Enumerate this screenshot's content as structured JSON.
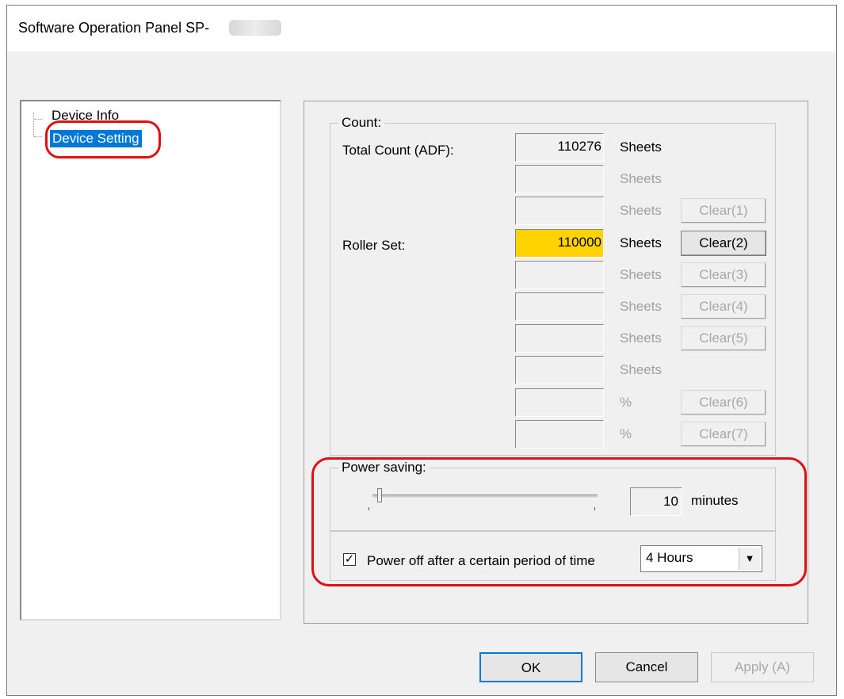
{
  "window": {
    "title": "Software Operation Panel SP-"
  },
  "tree": {
    "items": [
      "Device Info",
      "Device Setting"
    ],
    "selected": "Device Setting"
  },
  "count": {
    "legend": "Count:",
    "total_label": "Total Count (ADF):",
    "roller_label": "Roller Set:",
    "rows": [
      {
        "value": "110276",
        "unit": "Sheets",
        "unit_enabled": true,
        "button": null
      },
      {
        "value": "",
        "unit": "Sheets",
        "unit_enabled": false,
        "button": null
      },
      {
        "value": "",
        "unit": "Sheets",
        "unit_enabled": false,
        "button": "Clear(1)",
        "button_enabled": false
      },
      {
        "value": "110000",
        "unit": "Sheets",
        "unit_enabled": true,
        "button": "Clear(2)",
        "button_enabled": true,
        "highlight": "#ffd200"
      },
      {
        "value": "",
        "unit": "Sheets",
        "unit_enabled": false,
        "button": "Clear(3)",
        "button_enabled": false
      },
      {
        "value": "",
        "unit": "Sheets",
        "unit_enabled": false,
        "button": "Clear(4)",
        "button_enabled": false
      },
      {
        "value": "",
        "unit": "Sheets",
        "unit_enabled": false,
        "button": "Clear(5)",
        "button_enabled": false
      },
      {
        "value": "",
        "unit": "Sheets",
        "unit_enabled": false,
        "button": null
      },
      {
        "value": "",
        "unit": "%",
        "unit_enabled": false,
        "button": "Clear(6)",
        "button_enabled": false
      },
      {
        "value": "",
        "unit": "%",
        "unit_enabled": false,
        "button": "Clear(7)",
        "button_enabled": false
      }
    ]
  },
  "power": {
    "legend": "Power saving:",
    "minutes_value": "10",
    "minutes_unit": "minutes",
    "slider_level_fraction": 0.03,
    "checkbox_label": "Power off after a certain period of time",
    "checkbox_checked": true,
    "period_selected": "4 Hours"
  },
  "footer": {
    "ok": "OK",
    "cancel": "Cancel",
    "apply": "Apply (A)"
  },
  "colors": {
    "selection": "#0078d7",
    "highlight": "#ffd200",
    "annotation": "#e01010"
  }
}
